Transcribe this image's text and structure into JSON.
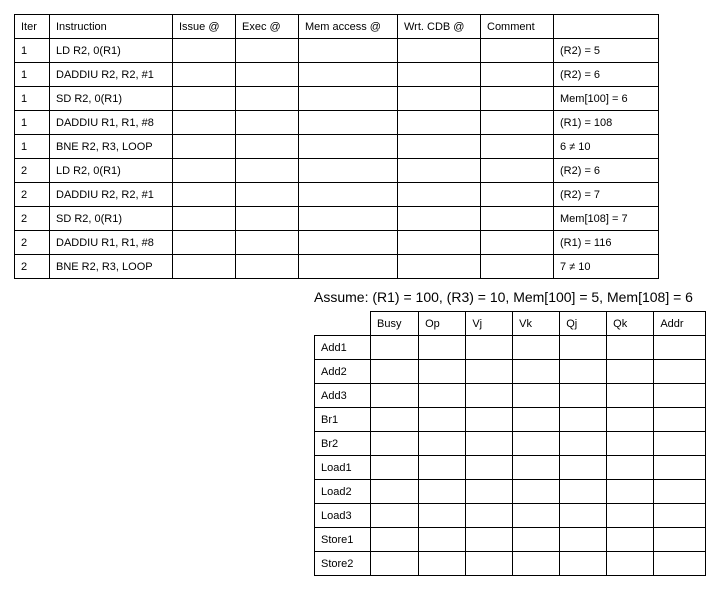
{
  "table1": {
    "headers": {
      "iter": "Iter",
      "instr": "Instruction",
      "issue": "Issue @",
      "exec": "Exec @",
      "mem": "Mem access @",
      "wrt": "Wrt. CDB @",
      "cmt": "Comment",
      "res": ""
    },
    "rows": [
      {
        "iter": "1",
        "instr": "LD R2, 0(R1)",
        "issue": "",
        "exec": "",
        "mem": "",
        "wrt": "",
        "cmt": "",
        "res": "(R2) = 5"
      },
      {
        "iter": "1",
        "instr": "DADDIU R2, R2, #1",
        "issue": "",
        "exec": "",
        "mem": "",
        "wrt": "",
        "cmt": "",
        "res": "(R2) = 6"
      },
      {
        "iter": "1",
        "instr": "SD R2, 0(R1)",
        "issue": "",
        "exec": "",
        "mem": "",
        "wrt": "",
        "cmt": "",
        "res": "Mem[100] = 6"
      },
      {
        "iter": "1",
        "instr": "DADDIU R1, R1, #8",
        "issue": "",
        "exec": "",
        "mem": "",
        "wrt": "",
        "cmt": "",
        "res": "(R1) = 108"
      },
      {
        "iter": "1",
        "instr": "BNE R2, R3, LOOP",
        "issue": "",
        "exec": "",
        "mem": "",
        "wrt": "",
        "cmt": "",
        "res": "6 ≠ 10"
      },
      {
        "iter": "2",
        "instr": "LD R2, 0(R1)",
        "issue": "",
        "exec": "",
        "mem": "",
        "wrt": "",
        "cmt": "",
        "res": "(R2) = 6"
      },
      {
        "iter": "2",
        "instr": "DADDIU R2, R2, #1",
        "issue": "",
        "exec": "",
        "mem": "",
        "wrt": "",
        "cmt": "",
        "res": "(R2) = 7"
      },
      {
        "iter": "2",
        "instr": "SD R2, 0(R1)",
        "issue": "",
        "exec": "",
        "mem": "",
        "wrt": "",
        "cmt": "",
        "res": "Mem[108] = 7"
      },
      {
        "iter": "2",
        "instr": "DADDIU R1, R1, #8",
        "issue": "",
        "exec": "",
        "mem": "",
        "wrt": "",
        "cmt": "",
        "res": "(R1) = 116"
      },
      {
        "iter": "2",
        "instr": "BNE R2, R3, LOOP",
        "issue": "",
        "exec": "",
        "mem": "",
        "wrt": "",
        "cmt": "",
        "res": "7 ≠ 10"
      }
    ]
  },
  "assume": "Assume: (R1) = 100, (R3) = 10, Mem[100] = 5, Mem[108] = 6",
  "table2": {
    "headers": {
      "busy": "Busy",
      "op": "Op",
      "vj": "Vj",
      "vk": "Vk",
      "qj": "Qj",
      "qk": "Qk",
      "addr": "Addr"
    },
    "rows": [
      {
        "name": "Add1",
        "busy": "",
        "op": "",
        "vj": "",
        "vk": "",
        "qj": "",
        "qk": "",
        "addr": ""
      },
      {
        "name": "Add2",
        "busy": "",
        "op": "",
        "vj": "",
        "vk": "",
        "qj": "",
        "qk": "",
        "addr": ""
      },
      {
        "name": "Add3",
        "busy": "",
        "op": "",
        "vj": "",
        "vk": "",
        "qj": "",
        "qk": "",
        "addr": ""
      },
      {
        "name": "Br1",
        "busy": "",
        "op": "",
        "vj": "",
        "vk": "",
        "qj": "",
        "qk": "",
        "addr": ""
      },
      {
        "name": "Br2",
        "busy": "",
        "op": "",
        "vj": "",
        "vk": "",
        "qj": "",
        "qk": "",
        "addr": ""
      },
      {
        "name": "Load1",
        "busy": "",
        "op": "",
        "vj": "",
        "vk": "",
        "qj": "",
        "qk": "",
        "addr": ""
      },
      {
        "name": "Load2",
        "busy": "",
        "op": "",
        "vj": "",
        "vk": "",
        "qj": "",
        "qk": "",
        "addr": ""
      },
      {
        "name": "Load3",
        "busy": "",
        "op": "",
        "vj": "",
        "vk": "",
        "qj": "",
        "qk": "",
        "addr": ""
      },
      {
        "name": "Store1",
        "busy": "",
        "op": "",
        "vj": "",
        "vk": "",
        "qj": "",
        "qk": "",
        "addr": ""
      },
      {
        "name": "Store2",
        "busy": "",
        "op": "",
        "vj": "",
        "vk": "",
        "qj": "",
        "qk": "",
        "addr": ""
      }
    ]
  }
}
